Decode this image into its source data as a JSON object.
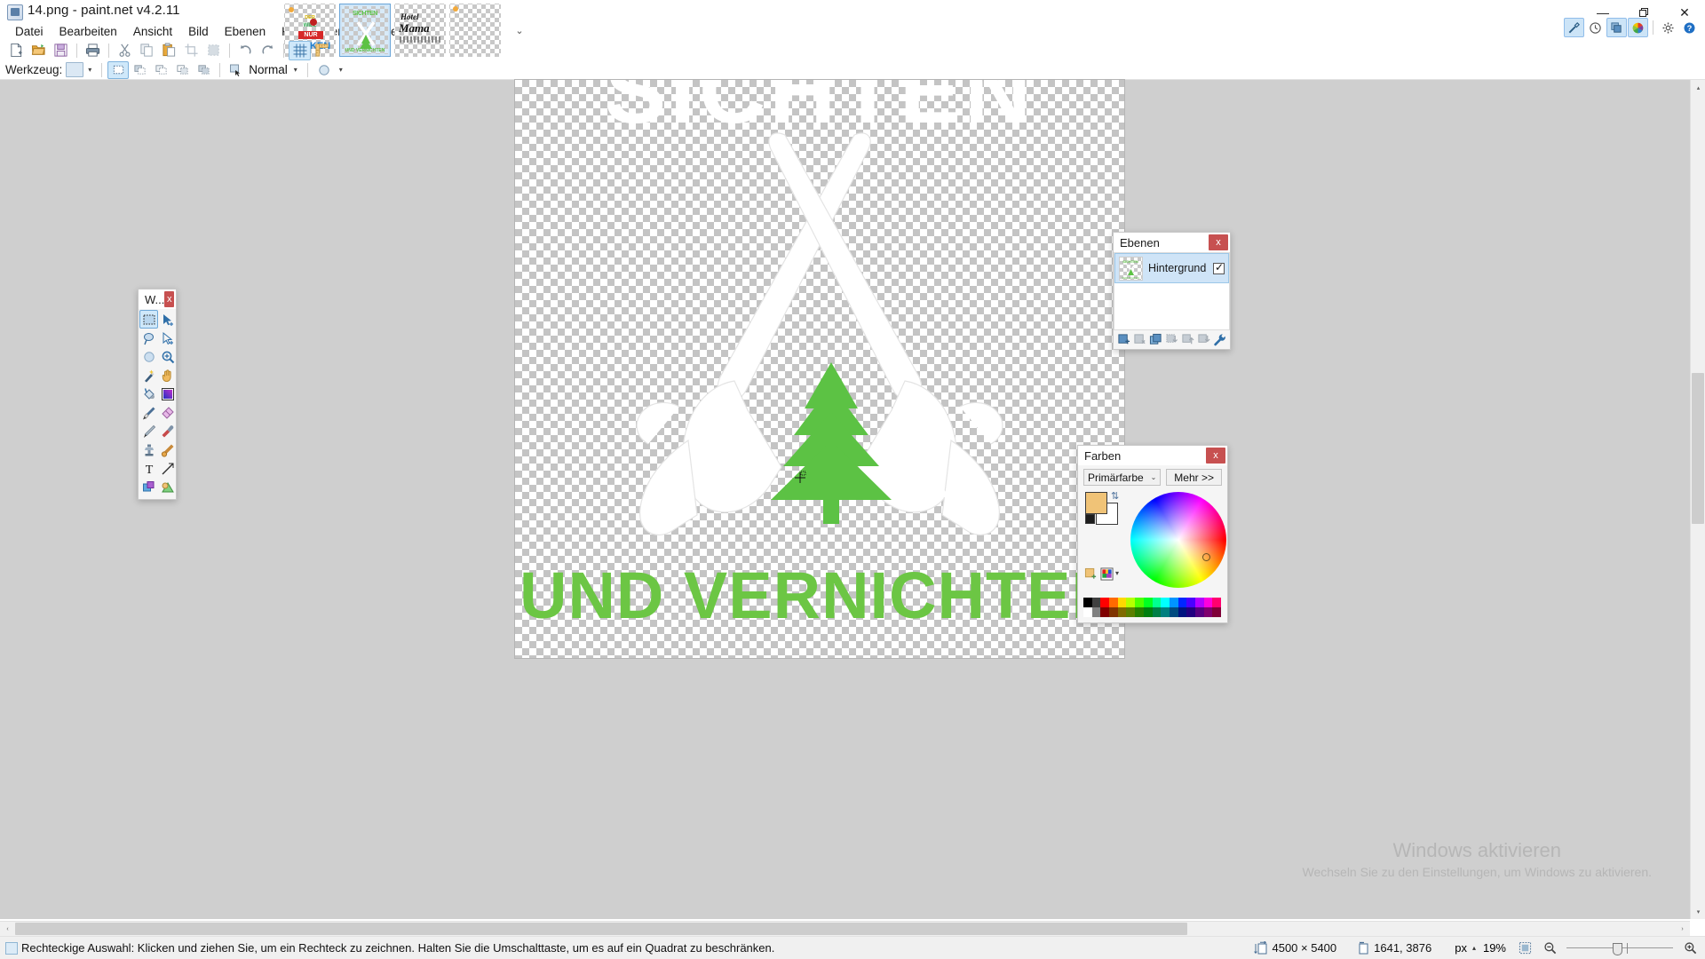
{
  "window": {
    "title": "14.png - paint.net v4.2.11",
    "app_icon": "paintdotnet-icon",
    "minimize": "—",
    "maximize": "❐",
    "close": "✕"
  },
  "menu": {
    "items": [
      {
        "label": "Datei",
        "name": "menu-datei"
      },
      {
        "label": "Bearbeiten",
        "name": "menu-bearbeiten"
      },
      {
        "label": "Ansicht",
        "name": "menu-ansicht"
      },
      {
        "label": "Bild",
        "name": "menu-bild"
      },
      {
        "label": "Ebenen",
        "name": "menu-ebenen"
      },
      {
        "label": "Korrekturen",
        "name": "menu-korrekturen"
      },
      {
        "label": "Effekte",
        "name": "menu-effekte"
      }
    ]
  },
  "thumbnails": {
    "dropdown_glyph": "⌄",
    "items": [
      {
        "name": "thumb-zocken",
        "selected": false,
        "caption": "ZOCKEN",
        "sub": "NUR"
      },
      {
        "name": "thumb-sichten",
        "selected": true,
        "caption": "SICHTEN",
        "sub": ""
      },
      {
        "name": "thumb-hotel-mama",
        "selected": false,
        "caption": "Hotel Mama",
        "sub": ""
      },
      {
        "name": "thumb-empty",
        "selected": false,
        "caption": "",
        "sub": ""
      }
    ]
  },
  "utility_buttons": [
    {
      "name": "tools-toggle-button",
      "glyph": "🔨",
      "active": true
    },
    {
      "name": "history-toggle-button",
      "glyph": "↺",
      "active": false
    },
    {
      "name": "layers-toggle-button",
      "glyph": "❐",
      "active": true
    },
    {
      "name": "colors-toggle-button",
      "glyph": "◉",
      "active": true
    },
    {
      "name": "settings-button",
      "glyph": "⚙",
      "active": false
    },
    {
      "name": "help-button",
      "glyph": "?",
      "active": false
    }
  ],
  "toolbar": {
    "buttons": [
      {
        "name": "new-button",
        "icon": "new-file-icon"
      },
      {
        "name": "open-button",
        "icon": "open-folder-icon"
      },
      {
        "name": "save-button",
        "icon": "save-disk-icon"
      },
      {
        "name": "print-button",
        "icon": "printer-icon"
      },
      {
        "name": "cut-button",
        "icon": "scissors-icon"
      },
      {
        "name": "copy-button",
        "icon": "copy-icon"
      },
      {
        "name": "paste-button",
        "icon": "paste-icon"
      },
      {
        "name": "crop-button",
        "icon": "crop-icon"
      },
      {
        "name": "deselect-button",
        "icon": "deselect-icon"
      },
      {
        "name": "undo-button",
        "icon": "undo-arrow-icon"
      },
      {
        "name": "redo-button",
        "icon": "redo-arrow-icon"
      },
      {
        "name": "grid-button",
        "icon": "grid-icon",
        "active": true
      },
      {
        "name": "rulers-button",
        "icon": "ruler-icon"
      }
    ]
  },
  "tool_options": {
    "label": "Werkzeug:",
    "tool_swatch": "rectangle-select-swatch",
    "caret": "▾",
    "selection_modes": [
      {
        "name": "selection-mode-replace",
        "active": true
      },
      {
        "name": "selection-mode-union",
        "active": false
      },
      {
        "name": "selection-mode-exclude",
        "active": false
      },
      {
        "name": "selection-mode-intersect",
        "active": false
      },
      {
        "name": "selection-mode-xor",
        "active": false
      }
    ],
    "fill_mode_label": "Normal",
    "fill_mode_caret": "▾",
    "antialias_caret": "▾"
  },
  "tools_window": {
    "title": "W...",
    "close": "x",
    "tools": [
      {
        "name": "tool-rectangle-select",
        "icon": "rectangle-select-icon",
        "active": true
      },
      {
        "name": "tool-move-selected",
        "icon": "move-selected-icon",
        "active": false
      },
      {
        "name": "tool-lasso-select",
        "icon": "lasso-select-icon",
        "active": false
      },
      {
        "name": "tool-move-selection",
        "icon": "move-selection-icon",
        "active": false
      },
      {
        "name": "tool-ellipse-select",
        "icon": "ellipse-select-icon",
        "active": false
      },
      {
        "name": "tool-zoom",
        "icon": "magnifier-icon",
        "active": false
      },
      {
        "name": "tool-magic-wand",
        "icon": "magic-wand-icon",
        "active": false
      },
      {
        "name": "tool-pan",
        "icon": "hand-pan-icon",
        "active": false
      },
      {
        "name": "tool-paint-bucket",
        "icon": "paint-bucket-icon",
        "active": false
      },
      {
        "name": "tool-gradient",
        "icon": "gradient-icon",
        "active": false
      },
      {
        "name": "tool-paintbrush",
        "icon": "paintbrush-icon",
        "active": false
      },
      {
        "name": "tool-eraser",
        "icon": "eraser-icon",
        "active": false
      },
      {
        "name": "tool-pencil",
        "icon": "pencil-icon",
        "active": false
      },
      {
        "name": "tool-color-picker",
        "icon": "color-picker-icon",
        "active": false
      },
      {
        "name": "tool-clone-stamp",
        "icon": "clone-stamp-icon",
        "active": false
      },
      {
        "name": "tool-recolor",
        "icon": "recolor-icon",
        "active": false
      },
      {
        "name": "tool-text",
        "icon": "text-icon",
        "active": false
      },
      {
        "name": "tool-line-curve",
        "icon": "line-curve-icon",
        "active": false
      },
      {
        "name": "tool-shapes",
        "icon": "shapes-icon",
        "active": false
      },
      {
        "name": "tool-shapes-2",
        "icon": "shapes-alt-icon",
        "active": false
      }
    ]
  },
  "layers_window": {
    "title": "Ebenen",
    "close": "x",
    "layers": [
      {
        "name": "layer-row-hintergrund",
        "label": "Hintergrund",
        "visible": true,
        "selected": true
      }
    ],
    "buttons": [
      {
        "name": "add-layer-button",
        "icon": "add-layer-icon"
      },
      {
        "name": "delete-layer-button",
        "icon": "delete-layer-icon"
      },
      {
        "name": "duplicate-layer-button",
        "icon": "duplicate-layer-icon"
      },
      {
        "name": "merge-layer-down-button",
        "icon": "merge-down-icon"
      },
      {
        "name": "move-layer-up-button",
        "icon": "move-up-icon"
      },
      {
        "name": "move-layer-down-button",
        "icon": "move-down-icon"
      },
      {
        "name": "layer-properties-button",
        "icon": "wrench-icon"
      }
    ]
  },
  "colors_window": {
    "title": "Farben",
    "close": "x",
    "mode_label": "Primärfarbe",
    "mode_caret": "⌄",
    "more_label": "Mehr >>",
    "primary_color": "#f0c377",
    "secondary_color": "#ffffff",
    "black_swatch": "#1d1d1d",
    "swap_icon": "swap-colors-icon",
    "wheel_icon": "color-wheel-icon",
    "add_palette_icon": "add-palette-icon",
    "palette_icon": "palette-icon",
    "palette_caret": "▾",
    "palette_colors": [
      "#000000",
      "#404040",
      "#ff0000",
      "#ff6a00",
      "#ffd800",
      "#b6ff00",
      "#4cff00",
      "#00ff21",
      "#00ff90",
      "#00ffff",
      "#0094ff",
      "#0026ff",
      "#4800ff",
      "#b200ff",
      "#ff00dc",
      "#ff006e",
      "#ffffff",
      "#808080",
      "#7f0000",
      "#7f3300",
      "#7f6a00",
      "#5b7f00",
      "#267f00",
      "#007f0e",
      "#007f46",
      "#007f7f",
      "#004a7f",
      "#00137f",
      "#21007f",
      "#57007f",
      "#7f006e",
      "#7f0037"
    ]
  },
  "canvas": {
    "artwork": {
      "top_text": "SICHTEN",
      "bottom_text": "UND VERNICHTEN",
      "top_text_color": "#ffffff",
      "bottom_text_color": "#6cc churn",
      "tree_color": "#5cc244",
      "chainsaw_color": "#ffffff",
      "background": "transparent-checker"
    },
    "cursor": "crosshair-rectselect-cursor"
  },
  "watermark": {
    "line1": "Windows aktivieren",
    "line2": "Wechseln Sie zu den Einstellungen, um Windows zu aktivieren."
  },
  "statusbar": {
    "tool_icon": "rectangle-select-icon",
    "hint": "Rechteckige Auswahl: Klicken und ziehen Sie, um ein Rechteck zu zeichnen. Halten Sie die Umschalttaste, um es auf ein Quadrat zu beschränken.",
    "image_size_icon": "image-size-icon",
    "image_size": "4500 × 5400",
    "cursor_pos_icon": "cursor-position-icon",
    "cursor_pos": "1641, 3876",
    "unit": "px",
    "unit_caret": "▴",
    "zoom_level": "19%",
    "fit_icon": "fit-to-window-icon",
    "zoom_out_icon": "zoom-out-icon",
    "zoom_in_icon": "zoom-in-icon"
  },
  "scrollbars": {
    "h_left_arrow": "‹",
    "h_right_arrow": "›",
    "v_up_arrow": "▴",
    "v_down_arrow": "▾"
  }
}
